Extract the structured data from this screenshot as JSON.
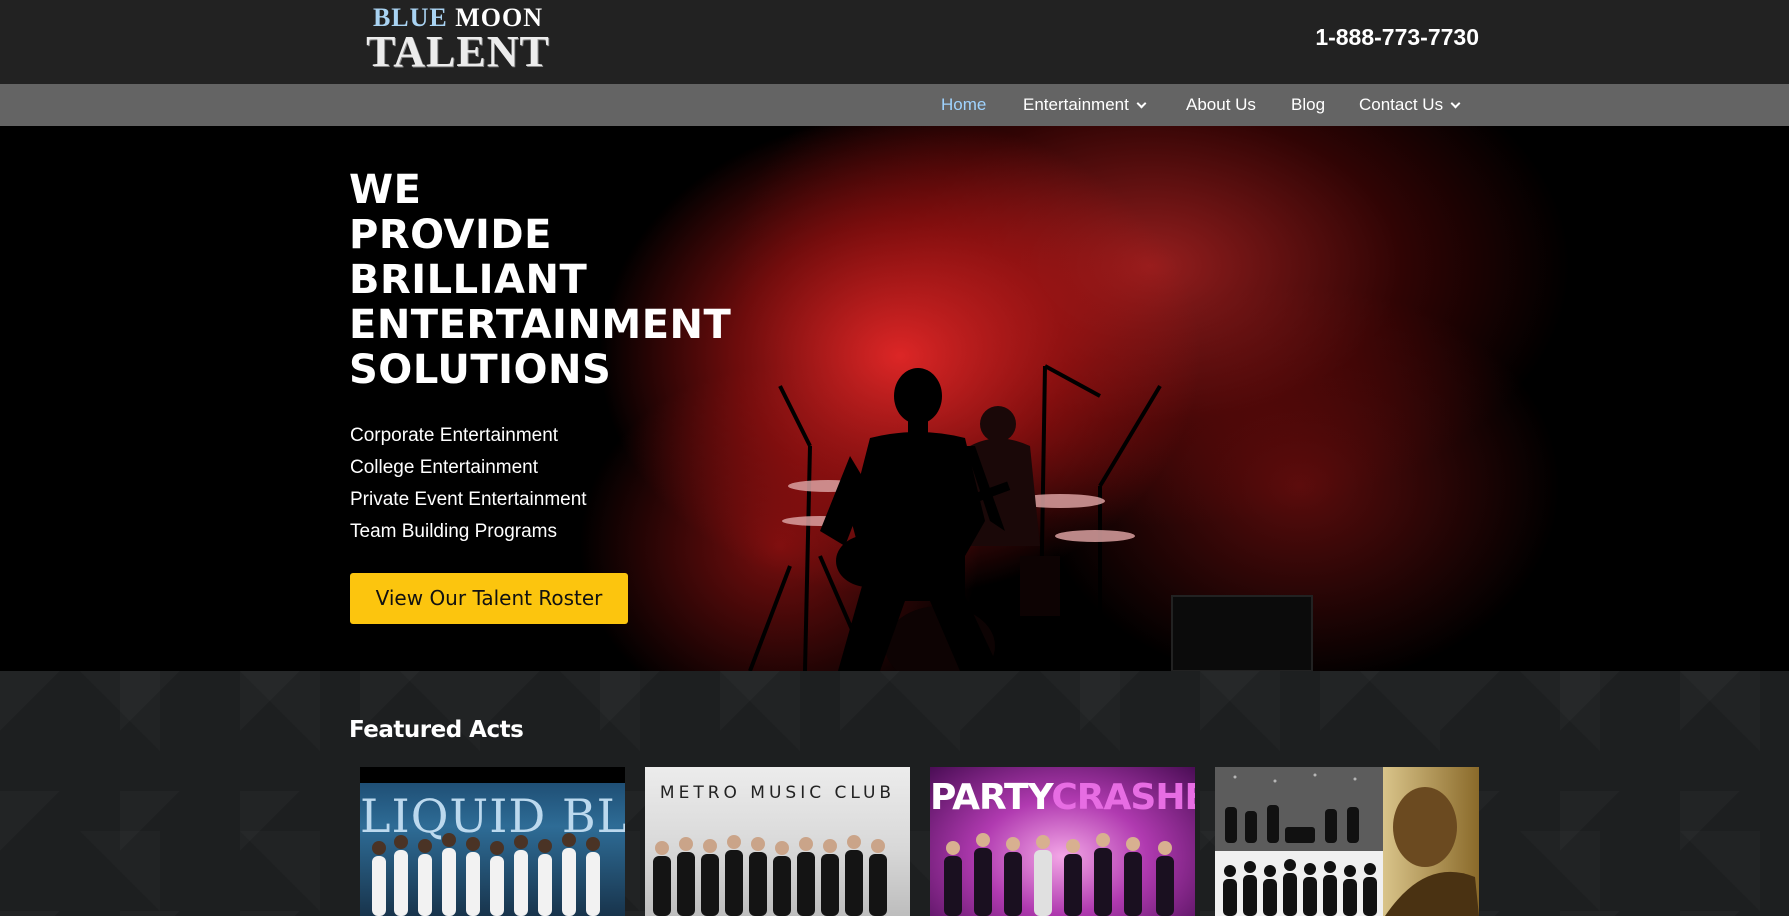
{
  "header": {
    "logo": {
      "line1_blue": "BLUE",
      "line1_white": "MOON",
      "line2": "TALENT"
    },
    "phone": "1-888-773-7730"
  },
  "nav": {
    "items": [
      {
        "label": "Home",
        "active": true,
        "has_dropdown": false
      },
      {
        "label": "Entertainment",
        "active": false,
        "has_dropdown": true
      },
      {
        "label": "About Us",
        "active": false,
        "has_dropdown": false
      },
      {
        "label": "Blog",
        "active": false,
        "has_dropdown": false
      },
      {
        "label": "Contact Us",
        "active": false,
        "has_dropdown": true
      }
    ]
  },
  "hero": {
    "title_lines": [
      "WE",
      "PROVIDE",
      "BRILLIANT",
      "ENTERTAINMENT",
      "SOLUTIONS"
    ],
    "services": [
      "Corporate Entertainment",
      "College Entertainment",
      "Private Event Entertainment",
      "Team Building Programs"
    ],
    "cta_label": "View Our Talent Roster"
  },
  "featured": {
    "title": "Featured Acts",
    "cards": [
      {
        "label": "LIQUID BLUE"
      },
      {
        "label": "METRO MUSIC CLUB"
      },
      {
        "label_a": "PARTY",
        "label_b": "CRASHERS"
      },
      {
        "label": ""
      }
    ]
  },
  "colors": {
    "header_bg": "#222222",
    "nav_bg": "#646464",
    "nav_active": "#9fd3ff",
    "cta_bg": "#fcc50e",
    "hero_red": "#e62828"
  }
}
